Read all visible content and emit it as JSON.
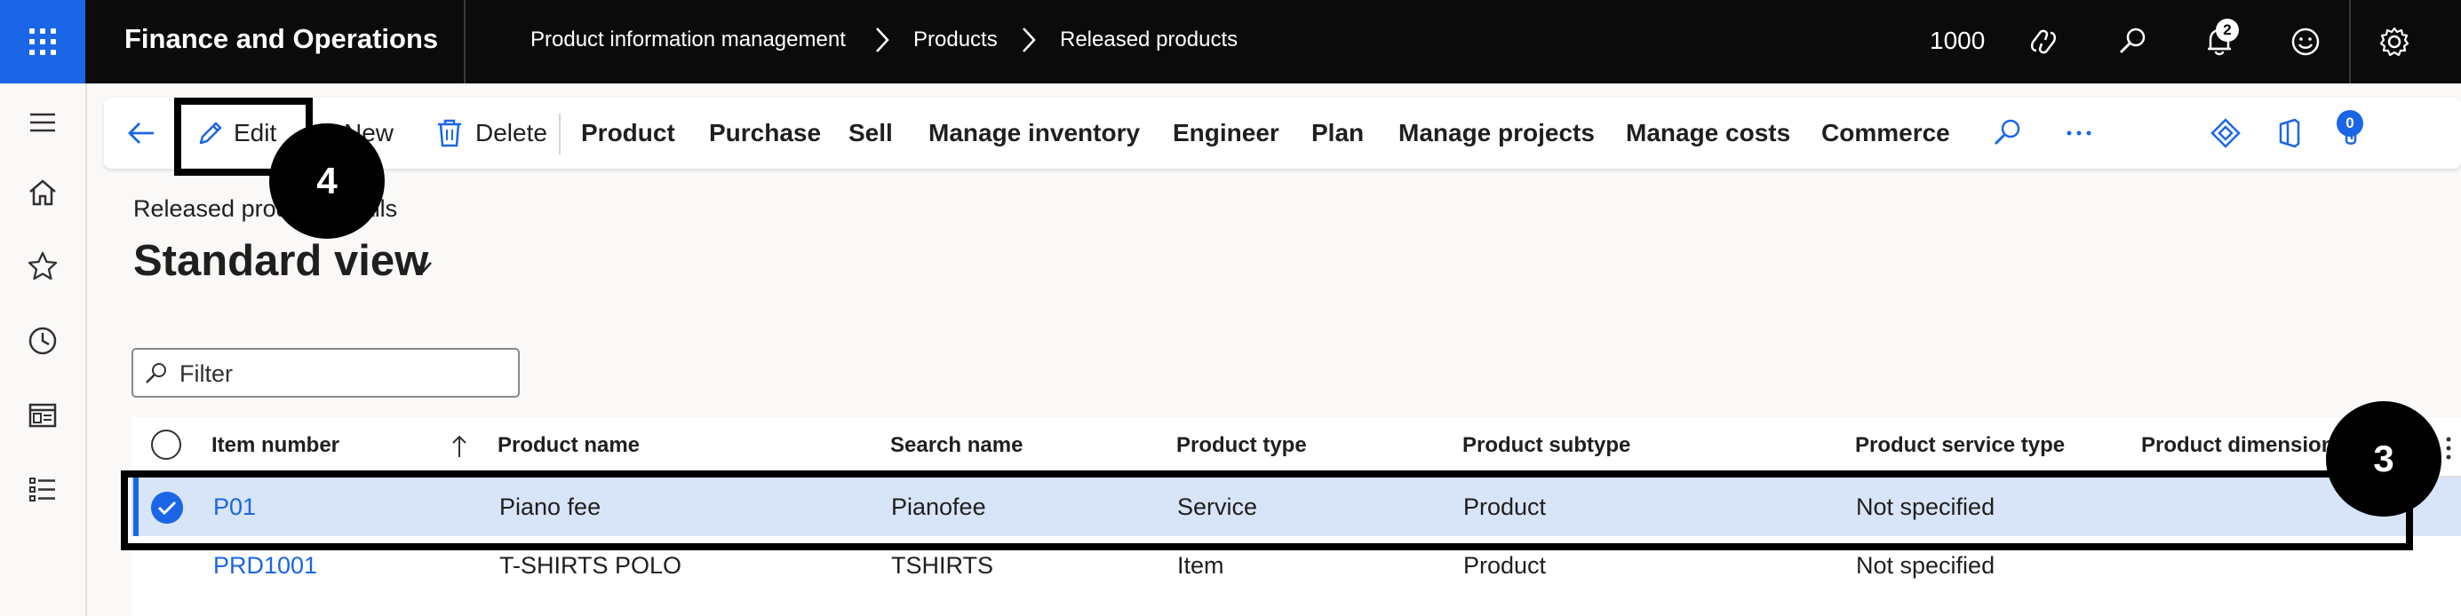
{
  "topbar": {
    "app_title": "Finance and Operations",
    "breadcrumb": [
      "Product information management",
      "Products",
      "Released products"
    ],
    "company": "1000",
    "notification_count": "2",
    "icons": [
      "app-launcher-icon",
      "copilot-icon",
      "search-icon",
      "notification-bell-icon",
      "feedback-smiley-icon",
      "settings-gear-icon"
    ]
  },
  "sidenav": {
    "icons": [
      "hamburger-menu-icon",
      "home-icon",
      "favorites-star-icon",
      "recent-clock-icon",
      "workspaces-icon",
      "modules-list-icon"
    ]
  },
  "actionpane": {
    "edit": "Edit",
    "new": "New",
    "delete": "Delete",
    "menus": [
      "Product",
      "Purchase",
      "Sell",
      "Manage inventory",
      "Engineer",
      "Plan",
      "Manage projects",
      "Manage costs",
      "Commerce"
    ],
    "attachments_count": "0"
  },
  "page": {
    "caption": "Released product details",
    "title": "Standard view"
  },
  "filter": {
    "placeholder": "Filter"
  },
  "grid": {
    "columns": [
      "Item number",
      "Product name",
      "Search name",
      "Product type",
      "Product subtype",
      "Product service type",
      "Product dimension"
    ],
    "rows": [
      {
        "item_number": "P01",
        "product_name": "Piano fee",
        "search_name": "Pianofee",
        "product_type": "Service",
        "product_subtype": "Product",
        "service_type": "Not specified",
        "selected": true
      },
      {
        "item_number": "PRD1001",
        "product_name": "T-SHIRTS POLO",
        "search_name": "TSHIRTS",
        "product_type": "Item",
        "product_subtype": "Product",
        "service_type": "Not specified",
        "selected": false
      }
    ]
  },
  "annotations": {
    "step_edit": "4",
    "step_row": "3"
  },
  "colors": {
    "brand_blue": "#1a66e6",
    "topbar_bg": "#0b0b0b",
    "selected_row": "#d8e4f8"
  }
}
